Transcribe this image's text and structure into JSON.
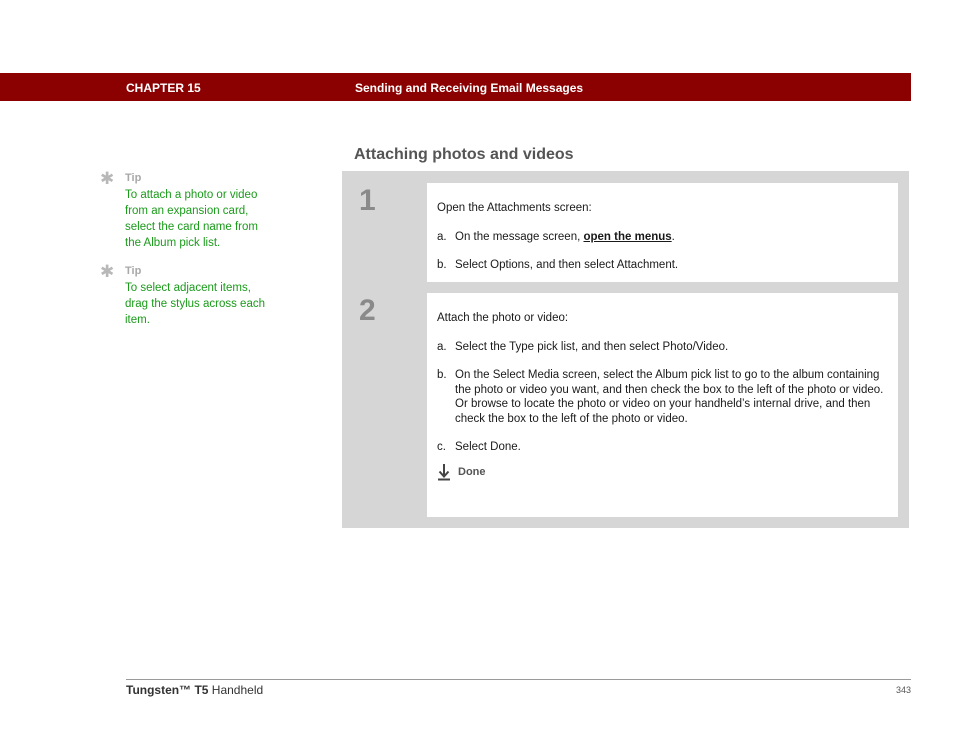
{
  "header": {
    "chapter": "CHAPTER 15",
    "title": "Sending and Receiving Email Messages"
  },
  "section_title": "Attaching photos and videos",
  "tips": [
    {
      "icon": "asterisk-icon",
      "label": "Tip",
      "text": "To attach a photo or video from an expansion card, select the card name from the Album pick list."
    },
    {
      "icon": "asterisk-icon",
      "label": "Tip",
      "text": "To select adjacent items, drag the stylus across each item."
    }
  ],
  "steps": [
    {
      "number": "1",
      "intro": "Open the Attachments screen:",
      "a_label": "a.",
      "a_before": "On the message screen, ",
      "a_link": "open the menus",
      "a_after": ".",
      "b_label": "b.",
      "b_text": "Select Options, and then select Attachment."
    },
    {
      "number": "2",
      "intro": "Attach the photo or video:",
      "a_label": "a.",
      "a_text": "Select the Type pick list, and then select Photo/Video.",
      "b_label": "b.",
      "b_text": "On the Select Media screen, select the Album pick list to go to the album containing the photo or video you want, and then check the box to the left of the photo or video. Or browse to locate the photo or video on your handheld’s internal drive, and then check the box to the left of the photo or video.",
      "c_label": "c.",
      "c_text": "Select Done.",
      "done_icon": "down-arrow-icon",
      "done_label": "Done"
    }
  ],
  "footer": {
    "product_name": "Tungsten™ T5",
    "product_suffix": " Handheld",
    "page_number": "343"
  },
  "colors": {
    "header_bar": "#8b0000",
    "tip_text": "#1a9b1a",
    "step_panel": "#d6d6d6"
  }
}
